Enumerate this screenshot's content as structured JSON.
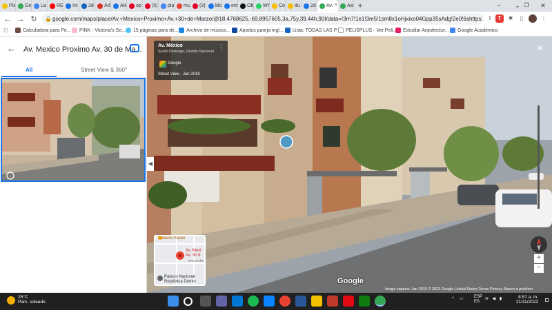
{
  "browser": {
    "tabs": [
      {
        "label": "Pla",
        "color": "#f2c200"
      },
      {
        "label": "Go",
        "color": "#34a853"
      },
      {
        "label": "La",
        "color": "#4285f4"
      },
      {
        "label": "RE",
        "color": "#ff0000"
      },
      {
        "label": "Ini",
        "color": "#1a73e8"
      },
      {
        "label": "2d",
        "color": "#1565c0"
      },
      {
        "label": "Árb",
        "color": "#d93025"
      },
      {
        "label": "Ale",
        "color": "#1a73e8"
      },
      {
        "label": "op",
        "color": "#e60023"
      },
      {
        "label": "(5)",
        "color": "#e60023"
      },
      {
        "label": "pla",
        "color": "#4285f4"
      },
      {
        "label": "mu",
        "color": "#ea4335"
      },
      {
        "label": "(8)",
        "color": "#e60023"
      },
      {
        "label": "blo",
        "color": "#1a73e8"
      },
      {
        "label": "ent",
        "color": "#1a73e8"
      },
      {
        "label": "Ob",
        "color": "#111111"
      },
      {
        "label": "Wh",
        "color": "#25d366"
      },
      {
        "label": "Co",
        "color": "#fbbc04"
      },
      {
        "label": "du",
        "color": "#fbbc04"
      },
      {
        "label": "2d",
        "color": "#1a73e8"
      },
      {
        "label": "Asi",
        "color": "#34a853"
      }
    ],
    "active_tab_label": "Av.",
    "url": "google.com/maps/place/Av.+Mexico+Proximo+Av.+30+de+Marzo/@18.4768625,-69.8957605,3a,75y,39.44h,90t/data=!3m7!1e1!3m5!1sm8x1oHjxixo04Gpp35sAdg!2e0!6shttps:%2...",
    "bookmarks": [
      "Calculadora para Pe...",
      "PINK - Victoria's Se...",
      "15 páginas para de...",
      "Archivo de música...",
      "Apodos pareja ingl...",
      "Lista: TODAS LAS P...",
      "PELISPLUS - Ver Peli...",
      "Estudiar Arquitectur...",
      "Google Académico"
    ]
  },
  "panel": {
    "title": "Av. Mexico Proximo Av. 30 de Ma...",
    "tab_all": "All",
    "tab_streetview": "Street View & 360°"
  },
  "streetview": {
    "place_title": "Av. México",
    "place_sub": "Santo Domingo, Distrito Nacional",
    "provider": "Google",
    "date_label": "Street View - Jan 2019",
    "logo": "Google",
    "attribution": "Image capture: Jan 2019  © 2022 Google   United States   Terms   Privacy   Report a problem",
    "minimap": {
      "label1": "Barra Payán",
      "label2": "Av. Mexi",
      "label3": "Av. 30 d",
      "label4": "SAN CARL",
      "label5": "Palacio Nacional",
      "label6": "República Domin"
    }
  },
  "taskbar": {
    "temp": "25°C",
    "weather": "Parc. soleado",
    "lang": "ESP",
    "region": "ES",
    "time": "8:57 a. m.",
    "date": "21/11/2022"
  }
}
